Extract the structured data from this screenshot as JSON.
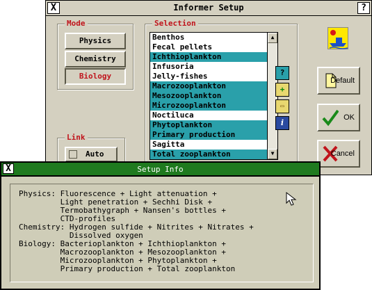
{
  "main_window": {
    "title": "Informer Setup",
    "close_glyph": "X",
    "help_glyph": "?"
  },
  "mode": {
    "label": "Mode",
    "buttons": [
      "Physics",
      "Chemistry",
      "Biology"
    ],
    "active": "Biology"
  },
  "selection": {
    "label": "Selection",
    "items": [
      {
        "text": "Benthos",
        "selected": false
      },
      {
        "text": "Fecal pellets",
        "selected": false
      },
      {
        "text": "Ichthioplankton",
        "selected": true
      },
      {
        "text": "Infusoria",
        "selected": false
      },
      {
        "text": "Jelly-fishes",
        "selected": false
      },
      {
        "text": "Macrozooplankton",
        "selected": true
      },
      {
        "text": "Mesozooplankton",
        "selected": true
      },
      {
        "text": "Microzooplankton",
        "selected": true
      },
      {
        "text": "Noctiluca",
        "selected": false
      },
      {
        "text": "Phytoplankton",
        "selected": true
      },
      {
        "text": "Primary production",
        "selected": true
      },
      {
        "text": "Sagitta",
        "selected": false
      },
      {
        "text": "Total zooplankton",
        "selected": true
      }
    ],
    "selected_color": "#2aa0aa"
  },
  "tools": [
    {
      "name": "help-icon",
      "glyph": "?"
    },
    {
      "name": "add-icon",
      "glyph": "+"
    },
    {
      "name": "open-folder-icon",
      "glyph": "▭"
    },
    {
      "name": "info-icon",
      "glyph": "i"
    }
  ],
  "link": {
    "label": "Link",
    "auto_label": "Auto"
  },
  "actions": {
    "default_label": "Default",
    "ok_label": "OK",
    "cancel_label": "Cancel"
  },
  "info_window": {
    "title": "Setup Info",
    "close_glyph": "X",
    "lines": [
      "Physics: Fluorescence + Light attenuation +",
      "         Light penetration + Sechhi Disk +",
      "         Termobathygraph + Nansen's bottles +",
      "         CTD-profiles",
      "Chemistry: Hydrogen sulfide + Nitrites + Nitrates +",
      "           Dissolved oxygen",
      "Biology: Bacterioplankton + Ichthioplankton +",
      "         Macrozooplankton + Mesozooplankton +",
      "         Microzooplankton + Phytoplankton +",
      "         Primary production + Total zooplankton"
    ]
  },
  "colors": {
    "accent_red": "#c0141c",
    "info_titlebar": "#1f7a1f",
    "dialog_bg": "#d4d0c0"
  }
}
